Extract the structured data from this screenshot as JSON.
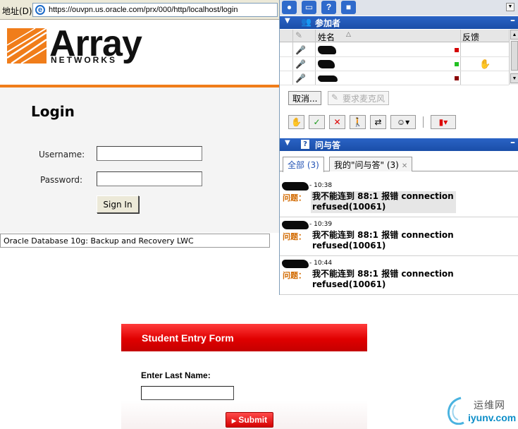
{
  "browser": {
    "address_label": "地址(D)",
    "url": "https://ouvpn.us.oracle.com/prx/000/http/localhost/login",
    "logo_word": "Array",
    "logo_sub": "NETWORKS",
    "login_title": "Login",
    "username_label": "Username:",
    "password_label": "Password:",
    "username_value": "",
    "password_value": "",
    "signin_label": "Sign In",
    "status_text": "Oracle Database 10g: Backup and Recovery LWC",
    "accent_color": "#f07d1a"
  },
  "meeting": {
    "toolbar_icons": [
      "participants-icon",
      "chat-icon",
      "help-icon",
      "camera-icon"
    ],
    "participants": {
      "title": "参加者",
      "col_name": "姓名",
      "col_feedback": "反馈",
      "rows": [
        {
          "mic": "on",
          "status_color": "#d40000",
          "feedback": ""
        },
        {
          "mic": "on",
          "status_color": "#22c022",
          "feedback": "✋"
        },
        {
          "mic": "off",
          "status_color": "#8b0000",
          "feedback": ""
        }
      ],
      "cancel_label": "取消...",
      "request_mic_label": "要求麦克风"
    },
    "qa": {
      "title": "问与答",
      "tab_all": "全部 (3)",
      "tab_mine": "我的\"问与答\" (3)",
      "question_label": "问题：",
      "items": [
        {
          "time": "- 10:38",
          "text": "我不能连到 88:1 报错 connection refused(10061)",
          "highlight": true
        },
        {
          "time": "- 10:39",
          "text": "我不能连到 88:1 报错 connection refused(10061)",
          "highlight": false
        },
        {
          "time": "- 10:44",
          "text": "我不能连到 88:1 报错 connection refused(10061)",
          "highlight": false
        }
      ]
    }
  },
  "form": {
    "title": "Student Entry Form",
    "label": "Enter Last Name:",
    "input_value": "",
    "submit_label": "Submit",
    "accent_color": "#e00000"
  },
  "watermark": {
    "cn": "运维网",
    "en": "iyunv.com"
  }
}
